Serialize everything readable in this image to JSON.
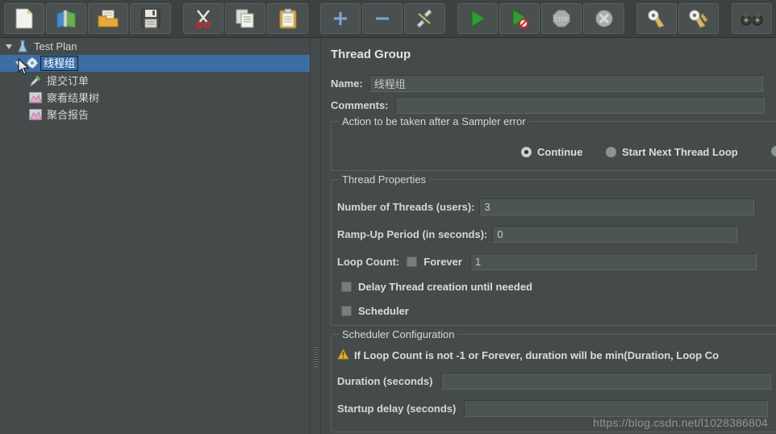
{
  "toolbar": {
    "buttons": [
      {
        "name": "new-test-plan-button",
        "icon": "new-document-icon",
        "tooltip": "New"
      },
      {
        "name": "templates-button",
        "icon": "templates-icon",
        "tooltip": "Templates"
      },
      {
        "name": "open-button",
        "icon": "open-folder-icon",
        "tooltip": "Open"
      },
      {
        "name": "save-button",
        "icon": "save-disk-icon",
        "tooltip": "Save Test Plan"
      },
      {
        "name": "cut-button",
        "icon": "scissors-icon",
        "tooltip": "Cut"
      },
      {
        "name": "copy-button",
        "icon": "copy-pages-icon",
        "tooltip": "Copy"
      },
      {
        "name": "paste-button",
        "icon": "clipboard-paste-icon",
        "tooltip": "Paste"
      },
      {
        "name": "expand-all-button",
        "icon": "plus-icon",
        "tooltip": "Expand All"
      },
      {
        "name": "collapse-all-button",
        "icon": "minus-icon",
        "tooltip": "Collapse All"
      },
      {
        "name": "toggle-button",
        "icon": "toggle-pencil-icon",
        "tooltip": "Toggle"
      },
      {
        "name": "start-button",
        "icon": "green-play-icon",
        "tooltip": "Start"
      },
      {
        "name": "start-no-pauses-button",
        "icon": "green-play-no-timers-icon",
        "tooltip": "Start no pauses"
      },
      {
        "name": "stop-button",
        "icon": "stop-octagon-icon",
        "tooltip": "Stop"
      },
      {
        "name": "shutdown-button",
        "icon": "shutdown-circle-icon",
        "tooltip": "Shutdown"
      },
      {
        "name": "clear-button",
        "icon": "clear-broom-icon",
        "tooltip": "Clear"
      },
      {
        "name": "clear-all-button",
        "icon": "clear-all-broom-icon",
        "tooltip": "Clear All"
      },
      {
        "name": "search-button",
        "icon": "binoculars-icon",
        "tooltip": "Search"
      }
    ]
  },
  "tree": {
    "nodes": [
      {
        "label": "Test Plan",
        "icon": "test-plan-icon",
        "depth": 0,
        "expanded": true,
        "selected": false,
        "editing": false
      },
      {
        "label": "线程组",
        "icon": "thread-group-icon",
        "depth": 1,
        "expanded": true,
        "selected": true,
        "editing": true
      },
      {
        "label": "提交订单",
        "icon": "http-sampler-icon",
        "depth": 2,
        "expanded": null,
        "selected": false,
        "editing": false
      },
      {
        "label": "察看结果树",
        "icon": "view-results-tree-icon",
        "depth": 2,
        "expanded": null,
        "selected": false,
        "editing": false
      },
      {
        "label": "聚合报告",
        "icon": "aggregate-report-icon",
        "depth": 2,
        "expanded": null,
        "selected": false,
        "editing": false
      }
    ]
  },
  "panel": {
    "title": "Thread Group",
    "name_label": "Name:",
    "name_value": "线程组",
    "comments_label": "Comments:",
    "comments_value": "",
    "sampler_error": {
      "legend": "Action to be taken after a Sampler error",
      "options": [
        {
          "label": "Continue",
          "selected": true
        },
        {
          "label": "Start Next Thread Loop",
          "selected": false
        },
        {
          "label": "",
          "selected": false
        }
      ]
    },
    "thread_properties": {
      "legend": "Thread Properties",
      "num_threads_label": "Number of Threads (users):",
      "num_threads_value": "3",
      "ramp_up_label": "Ramp-Up Period (in seconds):",
      "ramp_up_value": "0",
      "loop_count_label": "Loop Count:",
      "forever_label": "Forever",
      "forever_checked": false,
      "loop_count_value": "1",
      "delay_thread_label": "Delay Thread creation until needed",
      "delay_thread_checked": false,
      "scheduler_label": "Scheduler",
      "scheduler_checked": false
    },
    "scheduler_config": {
      "legend": "Scheduler Configuration",
      "warning": "If Loop Count is not -1 or Forever, duration will be min(Duration, Loop Co",
      "duration_label": "Duration (seconds)",
      "duration_value": "",
      "startup_delay_label": "Startup delay (seconds)",
      "startup_delay_value": ""
    }
  },
  "watermark": "https://blog.csdn.net/l1028386804",
  "colors": {
    "background": "#454b4b",
    "toolbar": "#3c4242",
    "selection": "#3a6ea5",
    "field": "#4d5454",
    "text": "#d6d6d6",
    "warning": "#e8b322"
  }
}
